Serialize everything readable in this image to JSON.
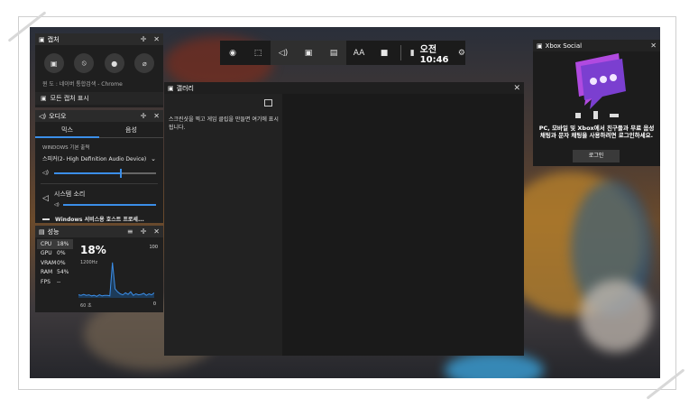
{
  "topbar": {
    "items": [
      {
        "name": "xbox-icon",
        "glyph": "◉"
      },
      {
        "name": "widget-menu-icon",
        "glyph": "⬚"
      },
      {
        "name": "audio-icon",
        "glyph": "◁)"
      },
      {
        "name": "capture-icon",
        "glyph": "▣"
      },
      {
        "name": "performance-icon",
        "glyph": "▤"
      },
      {
        "name": "party-icon",
        "glyph": "AA"
      },
      {
        "name": "gallery-icon",
        "glyph": "■"
      }
    ],
    "mouse_glyph": "▮",
    "time": "오전 10:46",
    "settings_glyph": "⚙"
  },
  "capture": {
    "title": "캡처",
    "buttons": [
      {
        "name": "screenshot-button",
        "glyph": "▣"
      },
      {
        "name": "record-last-button",
        "glyph": "⦸"
      },
      {
        "name": "record-button",
        "glyph": "●"
      },
      {
        "name": "mic-button",
        "glyph": "⌀"
      }
    ],
    "game": "윈 도 : 네이버 통합검색 - Chrome",
    "show_all": "모든 캡처 표시"
  },
  "audio": {
    "title": "오디오",
    "tabs": [
      "믹스",
      "음성"
    ],
    "section": "WINDOWS 기본 출력",
    "device": "스피커(2- High Definition Audio Device)",
    "master_level": 0.65,
    "system_sound": "시스템 소리",
    "system_level": 1.0,
    "service": "Windows 서비스용 호스트 프로세..."
  },
  "perf": {
    "title": "성능",
    "metrics": [
      {
        "label": "CPU",
        "value": "18%"
      },
      {
        "label": "GPU",
        "value": "0%"
      },
      {
        "label": "VRAM",
        "value": "0%"
      },
      {
        "label": "RAM",
        "value": "54%"
      },
      {
        "label": "FPS",
        "value": "--"
      }
    ],
    "big": "18%",
    "freq": "1200Hz",
    "max": "100",
    "min": "0",
    "span": "60 초",
    "series": [
      6,
      5,
      7,
      5,
      6,
      4,
      5,
      3,
      6,
      4,
      5,
      5,
      4,
      70,
      18,
      12,
      8,
      6,
      10,
      7,
      12,
      5,
      8,
      6,
      7,
      9,
      5,
      8,
      6,
      10
    ]
  },
  "gallery": {
    "title": "갤러리",
    "message": "스크린샷을 찍고 게임 클립을 만들면 여기에 표시됩니다."
  },
  "social": {
    "title": "Xbox Social",
    "message": "PC, 모바일 및 Xbox에서 친구들과 무료 음성 채팅과 문자 채팅을 사용하려면 로그인하세요.",
    "login": "로그인"
  }
}
